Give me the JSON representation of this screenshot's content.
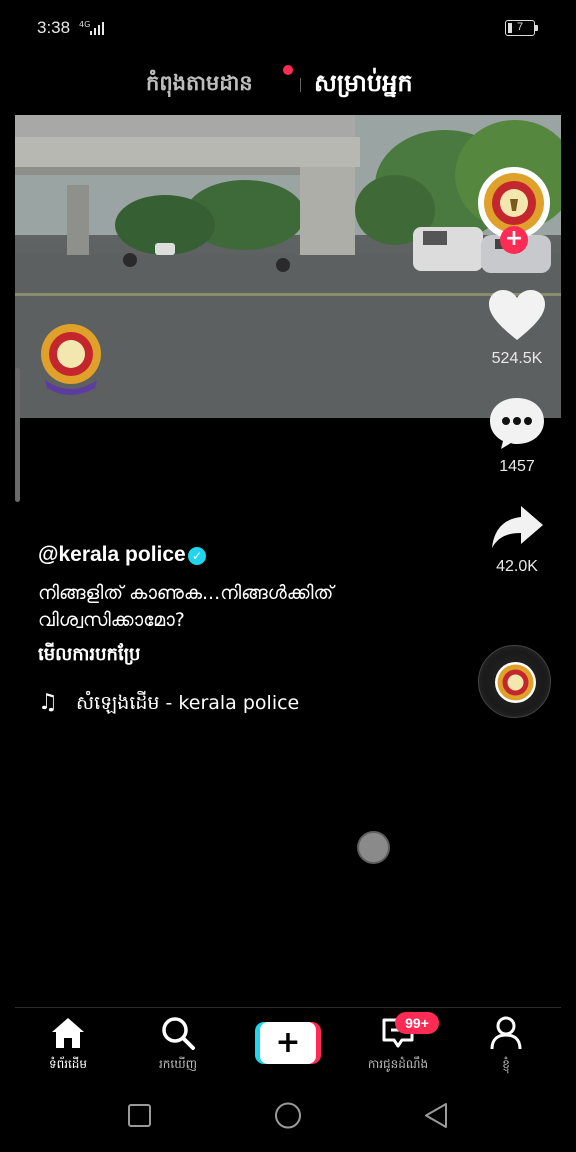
{
  "status_bar": {
    "time": "3:38",
    "network": "4G",
    "battery": "7"
  },
  "top_tabs": {
    "following": "កំពុងតាមដាន",
    "for_you": "សម្រាប់អ្នក"
  },
  "actions": {
    "likes": "524.5K",
    "comments": "1457",
    "shares": "42.0K"
  },
  "post": {
    "author": "@kerala police",
    "caption": "നിങ്ങളിത് കാണുക...നിങ്ങൾക്കിത് വിശ്വസിക്കാമോ?",
    "see_translation": "មើលការបកប្រែ",
    "sound": "សំឡេងដើម - kerala police"
  },
  "bottom_nav": {
    "home": "ទំព័រដើម",
    "discover": "រកឃើញ",
    "create": "+",
    "inbox": "ការជូនដំណឹង",
    "inbox_badge": "99+",
    "profile": "ខ្ញុំ"
  },
  "icons": {
    "like": "heart-icon",
    "comment": "comment-bubble-icon",
    "share": "share-arrow-icon",
    "music": "music-note-icon",
    "home": "home-icon",
    "discover": "search-icon",
    "inbox": "inbox-icon",
    "profile": "person-icon"
  },
  "colors": {
    "accent_red": "#fe2c55",
    "accent_cyan": "#20d5ec",
    "background": "#000000"
  }
}
